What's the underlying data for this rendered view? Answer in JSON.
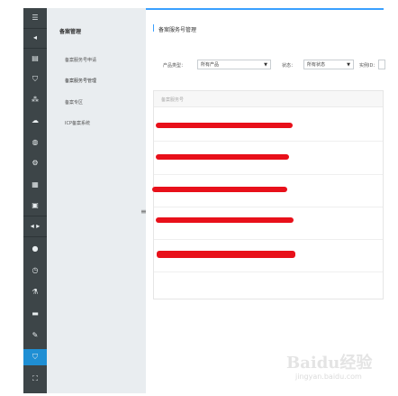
{
  "rail": {
    "items": [
      {
        "name": "menu-icon",
        "glyph": "☰"
      },
      {
        "name": "collapse-icon",
        "glyph": "◂"
      },
      {
        "name": "list-icon",
        "glyph": "▤"
      },
      {
        "name": "shield-icon",
        "glyph": "⛉"
      },
      {
        "name": "network-icon",
        "glyph": "⁂"
      },
      {
        "name": "cloud-icon",
        "glyph": "☁"
      },
      {
        "name": "globe-icon",
        "glyph": "◍"
      },
      {
        "name": "gear-circle-icon",
        "glyph": "⚙"
      },
      {
        "name": "database-icon",
        "glyph": "▦"
      },
      {
        "name": "storage-icon",
        "glyph": "▣"
      },
      {
        "name": "expand-icon",
        "glyph": "◂ ▸"
      },
      {
        "name": "user-icon",
        "glyph": "●"
      },
      {
        "name": "clock-icon",
        "glyph": "◷"
      },
      {
        "name": "flask-icon",
        "glyph": "⚗"
      },
      {
        "name": "mail-icon",
        "glyph": "▬"
      },
      {
        "name": "edit-icon",
        "glyph": "✎"
      },
      {
        "name": "record-shield-icon",
        "glyph": "⛉"
      },
      {
        "name": "tree-icon",
        "glyph": "⛶"
      }
    ]
  },
  "subnav": {
    "title": "备案管理",
    "items": [
      "备案服务号申请",
      "备案服务号管理",
      "备案专区",
      "ICP备案系统"
    ]
  },
  "main": {
    "title": "备案服务号管理",
    "filters": {
      "product_label": "产品类型：",
      "product_value": "所有产品",
      "status_label": "状态：",
      "status_value": "所有状态",
      "instance_label": "实例ID："
    },
    "table": {
      "header": "备案服务号"
    }
  },
  "colors": {
    "rail": "#3d4548",
    "active": "#1f8fd4",
    "accent": "#3aa0ff",
    "redaction": "#e8101a"
  },
  "watermark": {
    "brand": "Baidu经验",
    "url": "jingyan.baidu.com"
  }
}
